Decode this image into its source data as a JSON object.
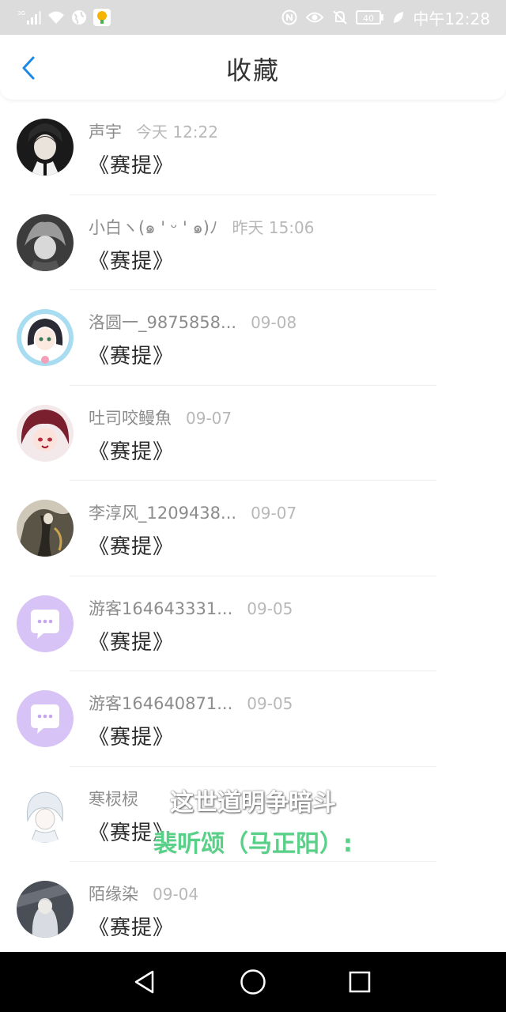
{
  "status_bar": {
    "network": "3G",
    "battery": "40",
    "time": "中午12:28",
    "icons": [
      "signal-icon",
      "wifi-icon",
      "globe-icon",
      "app-notification-icon",
      "nfc-icon",
      "eye-icon",
      "bell-off-icon",
      "battery-icon",
      "leaf-icon"
    ]
  },
  "header": {
    "title": "收藏",
    "back_icon": "chevron-left-icon",
    "accent_color": "#1e88e5"
  },
  "items": [
    {
      "name": "声宇",
      "time": "今天 12:22",
      "work": "《赛提》",
      "avatar": "anime-avatar"
    },
    {
      "name": "小白ヽ(๑ ' ᵕ ' ๑)ﾉ",
      "time": "昨天 15:06",
      "work": "《赛提》",
      "avatar": "anime-avatar"
    },
    {
      "name": "洛圆一_9875858...",
      "time": "09-08",
      "work": "《赛提》",
      "avatar": "anime-avatar"
    },
    {
      "name": "吐司咬鳗魚",
      "time": "09-07",
      "work": "《赛提》",
      "avatar": "anime-avatar"
    },
    {
      "name": "李淳风_1209438...",
      "time": "09-07",
      "work": "《赛提》",
      "avatar": "anime-avatar"
    },
    {
      "name": "游客164643331...",
      "time": "09-05",
      "work": "《赛提》",
      "avatar": "default-chat-avatar"
    },
    {
      "name": "游客164640871...",
      "time": "09-05",
      "work": "《赛提》",
      "avatar": "default-chat-avatar"
    },
    {
      "name": "寒棂棂",
      "time": "",
      "work": "《赛提》",
      "avatar": "anime-avatar"
    },
    {
      "name": "陌缘染",
      "time": "09-04",
      "work": "《赛提》",
      "avatar": "anime-avatar"
    }
  ],
  "subtitles": {
    "line1": "这世道明争暗斗",
    "line2": "裴听颂（马正阳）:"
  },
  "nav": {
    "back": "triangle-back-icon",
    "home": "circle-home-icon",
    "recents": "square-recents-icon"
  }
}
